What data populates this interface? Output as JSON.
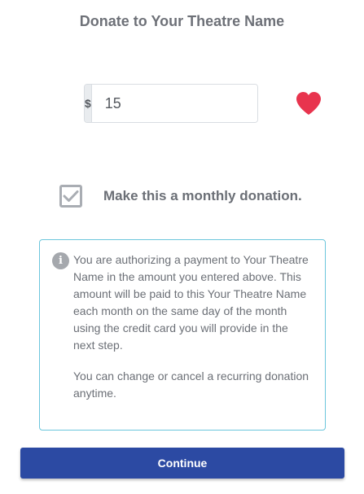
{
  "header": {
    "title": "Donate to Your Theatre Name"
  },
  "amount": {
    "currency_symbol": "$",
    "value": "15"
  },
  "monthly": {
    "checked": true,
    "label": "Make this a monthly donation."
  },
  "info": {
    "paragraph1": "You are authorizing a payment to Your Theatre Name in the amount you entered above. This amount will be paid to this Your Theatre Name each month on the same day of the month using the credit card you will provide in the next step.",
    "paragraph2": "You can change or cancel a recurring donation anytime."
  },
  "actions": {
    "continue_label": "Continue"
  },
  "colors": {
    "heart": "#e8344e",
    "button": "#2c4aa3",
    "info_border": "#6cc6dc"
  },
  "icons": {
    "heart": "heart-icon",
    "check": "checkmark-icon",
    "info": "info-icon"
  }
}
